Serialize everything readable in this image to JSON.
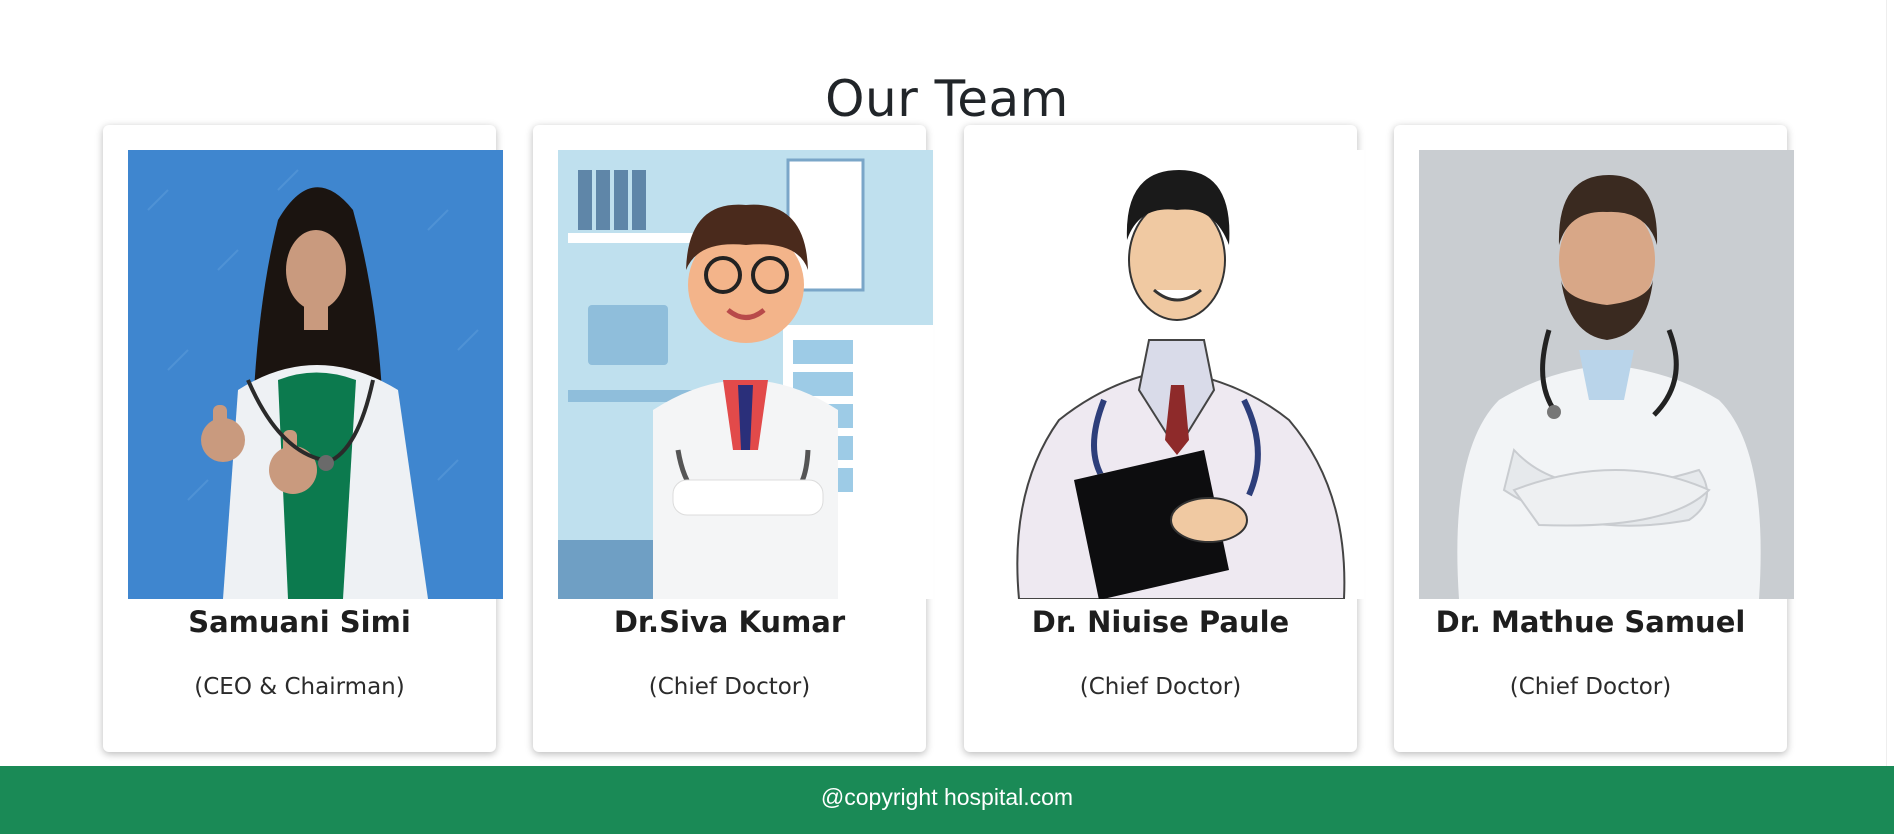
{
  "section": {
    "title": "Our Team"
  },
  "team": [
    {
      "name": "Samuani Simi",
      "role": "(CEO & Chairman)",
      "photo_icon": "doctor-woman-photo"
    },
    {
      "name": "Dr.Siva Kumar",
      "role": "(Chief Doctor)",
      "photo_icon": "doctor-cartoon-photo"
    },
    {
      "name": "Dr. Niuise Paule",
      "role": "(Chief Doctor)",
      "photo_icon": "doctor-illustration-photo"
    },
    {
      "name": "Dr. Mathue Samuel",
      "role": "(Chief Doctor)",
      "photo_icon": "doctor-man-photo"
    }
  ],
  "footer": {
    "text": "@copyright hospital.com"
  },
  "colors": {
    "footer_bg": "#1a8a56",
    "photo1_bg": "#3f86cf",
    "photo2_bg": "#bfe0ee",
    "photo4_bg": "#c9cdd1"
  }
}
